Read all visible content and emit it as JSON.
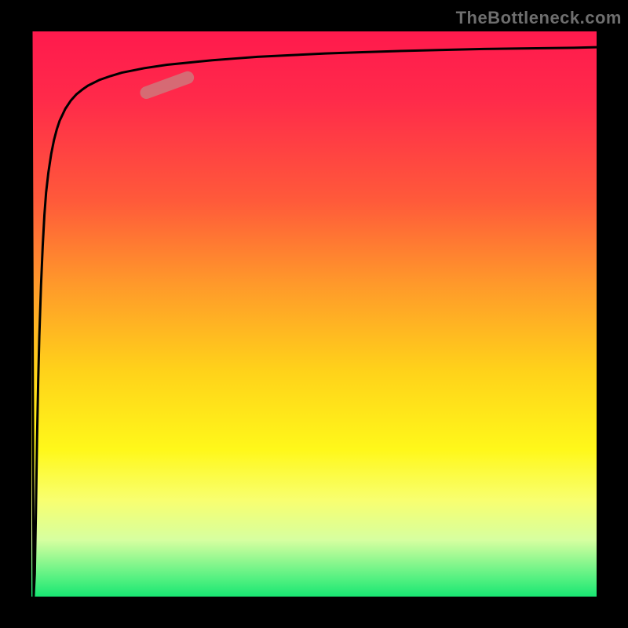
{
  "attribution": "TheBottleneck.com",
  "colors": {
    "background": "#000000",
    "curve": "#000000",
    "marker": "rgba(200,130,130,0.75)",
    "gradient_top": "#ff1a4d",
    "gradient_bottom": "#18e672"
  },
  "chart_data": {
    "type": "line",
    "title": "",
    "xlabel": "",
    "ylabel": "",
    "xlim": [
      0,
      100
    ],
    "ylim": [
      0,
      100
    ],
    "grid": false,
    "legend": false,
    "series": [
      {
        "name": "bottleneck-curve",
        "x": [
          0,
          0.4,
          0.6,
          0.8,
          1.0,
          1.2,
          1.4,
          1.7,
          2.0,
          2.3,
          2.6,
          3.0,
          3.5,
          4.0,
          4.5,
          5.0,
          6.0,
          7.0,
          8.0,
          9.0,
          10.0,
          12.0,
          14.0,
          16.0,
          18.0,
          20.0,
          24.0,
          28.0,
          32.0,
          36.0,
          40.0,
          46.0,
          52.0,
          58.0,
          64.0,
          72.0,
          80.0,
          88.0,
          96.0,
          100.0
        ],
        "y": [
          100,
          0,
          4,
          15,
          28,
          38,
          46,
          55,
          62,
          67.5,
          71.5,
          75,
          78.3,
          80.8,
          82.7,
          84.2,
          86.3,
          87.8,
          88.9,
          89.7,
          90.4,
          91.4,
          92.1,
          92.7,
          93.1,
          93.5,
          94.1,
          94.5,
          94.9,
          95.2,
          95.5,
          95.8,
          96.1,
          96.3,
          96.5,
          96.7,
          96.9,
          97.0,
          97.1,
          97.2
        ]
      }
    ],
    "marker": {
      "x_center": 24,
      "y_center": 90.5,
      "length": 10,
      "angle_deg": 20
    }
  }
}
